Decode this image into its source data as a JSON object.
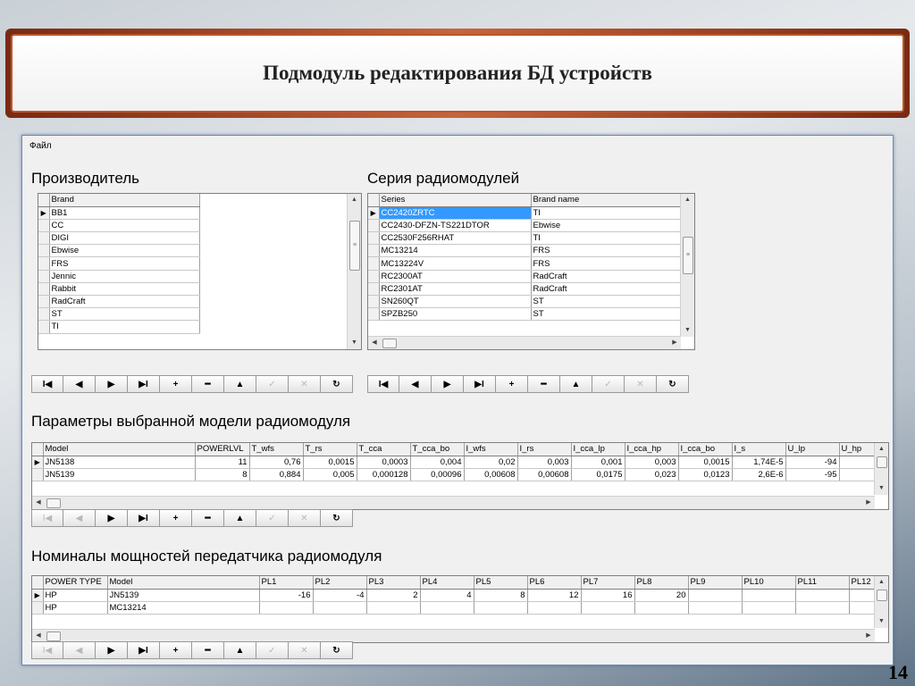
{
  "slide": {
    "title": "Подмодуль редактирования БД устройств",
    "page_number": "14"
  },
  "menu": {
    "file": "Файл"
  },
  "sections": {
    "brand": "Производитель",
    "series": "Серия радиомодулей",
    "params": "Параметры выбранной модели радиомодуля",
    "power": "Номиналы мощностей передатчика  радиомодуля"
  },
  "brand_grid": {
    "header": "Brand",
    "rows": [
      "BB1",
      "CC",
      "DIGI",
      "Ebwise",
      "FRS",
      "Jennic",
      "Rabbit",
      "RadCraft",
      "ST",
      "TI"
    ],
    "current_row": 0
  },
  "series_grid": {
    "headers": [
      "Series",
      "Brand name"
    ],
    "rows": [
      [
        "CC2420ZRTC",
        "TI"
      ],
      [
        "CC2430-DFZN-TS221DTOR",
        "Ebwise"
      ],
      [
        "CC2530F256RHAT",
        "TI"
      ],
      [
        "MC13214",
        "FRS"
      ],
      [
        "MC13224V",
        "FRS"
      ],
      [
        "RC2300AT",
        "RadCraft"
      ],
      [
        "RC2301AT",
        "RadCraft"
      ],
      [
        "SN260QT",
        " ST"
      ],
      [
        "SPZB250",
        "ST"
      ]
    ],
    "current_row": 0
  },
  "params_grid": {
    "headers": [
      "Model",
      "POWERLVL",
      "T_wfs",
      "T_rs",
      "T_cca",
      "T_cca_bo",
      "I_wfs",
      "I_rs",
      "I_cca_lp",
      "I_cca_hp",
      "I_cca_bo",
      "I_s",
      "U_lp",
      "U_hp"
    ],
    "rows": [
      [
        "JN5138",
        "11",
        "0,76",
        "0,0015",
        "0,0003",
        "0,004",
        "0,02",
        "0,003",
        "0,001",
        "0,003",
        "0,0015",
        "1,74E-5",
        "-94",
        ""
      ],
      [
        "JN5139",
        "8",
        "0,884",
        "0,005",
        "0,000128",
        "0,00096",
        "0,00608",
        "0,00608",
        "0,0175",
        "0,023",
        "0,0123",
        "2,6E-6",
        "-95",
        ""
      ]
    ],
    "current_row": 0
  },
  "power_grid": {
    "headers": [
      "POWER TYPE",
      "Model",
      "PL1",
      "PL2",
      "PL3",
      "PL4",
      "PL5",
      "PL6",
      "PL7",
      "PL8",
      "PL9",
      "PL10",
      "PL11",
      "PL12"
    ],
    "rows": [
      [
        "HP",
        "  JN5139",
        "-16",
        "-4",
        "2",
        "4",
        "8",
        "12",
        "16",
        "20",
        "",
        "",
        "",
        ""
      ],
      [
        "HP",
        "MC13214",
        "",
        "",
        "",
        "",
        "",
        "",
        "",
        "",
        "",
        "",
        "",
        ""
      ]
    ],
    "current_row": 0
  },
  "navigator": {
    "icons": [
      "first-icon",
      "prior-icon",
      "next-icon",
      "last-icon",
      "insert-icon",
      "delete-icon",
      "edit-icon",
      "post-icon",
      "cancel-icon",
      "refresh-icon"
    ],
    "glyphs": [
      "I◀",
      "◀",
      "▶",
      "▶I",
      "+",
      "━",
      "▲",
      "✓",
      "✕",
      "↻"
    ],
    "disabled_top": [
      false,
      false,
      false,
      false,
      false,
      false,
      false,
      true,
      true,
      false
    ],
    "disabled_bottom": [
      true,
      true,
      false,
      false,
      false,
      false,
      false,
      true,
      true,
      false
    ]
  }
}
